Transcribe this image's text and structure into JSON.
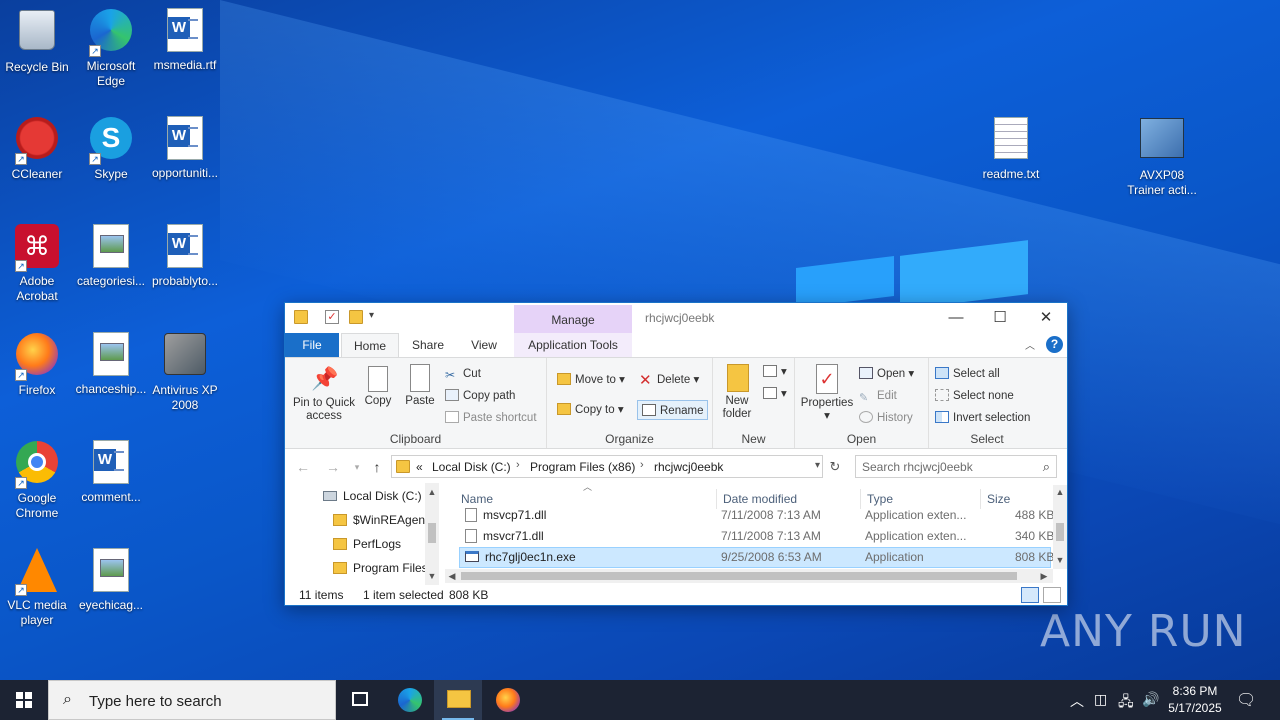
{
  "desktop": {
    "icons": [
      {
        "label": "Recycle Bin"
      },
      {
        "label": "Microsoft Edge"
      },
      {
        "label": "msmedia.rtf"
      },
      {
        "label": "CCleaner"
      },
      {
        "label": "Skype"
      },
      {
        "label": "opportuniti..."
      },
      {
        "label": "Adobe Acrobat"
      },
      {
        "label": "categoriesi..."
      },
      {
        "label": "probablyto..."
      },
      {
        "label": "Firefox"
      },
      {
        "label": "chanceship..."
      },
      {
        "label": "Antivirus XP 2008"
      },
      {
        "label": "Google Chrome"
      },
      {
        "label": "comment..."
      },
      {
        "label": "VLC media player"
      },
      {
        "label": "eyechicag..."
      },
      {
        "label": "readme.txt"
      },
      {
        "label": "AVXP08 Trainer acti..."
      }
    ],
    "watermark": "ANY RUN"
  },
  "explorer": {
    "title": "rhcjwcj0eebk",
    "manage_tab": "Manage",
    "window_controls": {
      "minimize": "—",
      "maximize": "☐",
      "close": "✕"
    },
    "tabs": [
      {
        "label": "File"
      },
      {
        "label": "Home"
      },
      {
        "label": "Share"
      },
      {
        "label": "View"
      },
      {
        "label": "Application Tools"
      }
    ],
    "ribbon": {
      "clipboard": {
        "label": "Clipboard",
        "pin": "Pin to Quick access",
        "copy": "Copy",
        "paste": "Paste",
        "cut": "Cut",
        "copy_path": "Copy path",
        "paste_shortcut": "Paste shortcut"
      },
      "organize": {
        "label": "Organize",
        "move_to": "Move to",
        "copy_to": "Copy to",
        "delete": "Delete",
        "rename": "Rename"
      },
      "new": {
        "label": "New",
        "new_folder": "New folder"
      },
      "open": {
        "label": "Open",
        "properties": "Properties",
        "open": "Open",
        "edit": "Edit",
        "history": "History"
      },
      "select": {
        "label": "Select",
        "select_all": "Select all",
        "select_none": "Select none",
        "invert_selection": "Invert selection"
      }
    },
    "address": {
      "prefix": "«",
      "crumbs": [
        "Local Disk (C:)",
        "Program Files (x86)",
        "rhcjwcj0eebk"
      ],
      "separator": "›"
    },
    "search": {
      "placeholder": "Search rhcjwcj0eebk"
    },
    "nav_pane": [
      {
        "label": "Local Disk (C:)"
      },
      {
        "label": "$WinREAgent"
      },
      {
        "label": "PerfLogs"
      },
      {
        "label": "Program Files"
      }
    ],
    "columns": {
      "name": "Name",
      "date": "Date modified",
      "type": "Type",
      "size": "Size"
    },
    "files": [
      {
        "name": "msvcp71.dll",
        "date": "7/11/2008 7:13 AM",
        "type": "Application exten...",
        "size": "488 KB"
      },
      {
        "name": "msvcr71.dll",
        "date": "7/11/2008 7:13 AM",
        "type": "Application exten...",
        "size": "340 KB"
      },
      {
        "name": "rhc7glj0ec1n.exe",
        "date": "9/25/2008 6:53 AM",
        "type": "Application",
        "size": "808 KB"
      }
    ],
    "status": {
      "items": "11 items",
      "selected": "1 item selected",
      "size": "808 KB"
    }
  },
  "taskbar": {
    "search_placeholder": "Type here to search",
    "time": "8:36 PM",
    "date": "5/17/2025"
  }
}
